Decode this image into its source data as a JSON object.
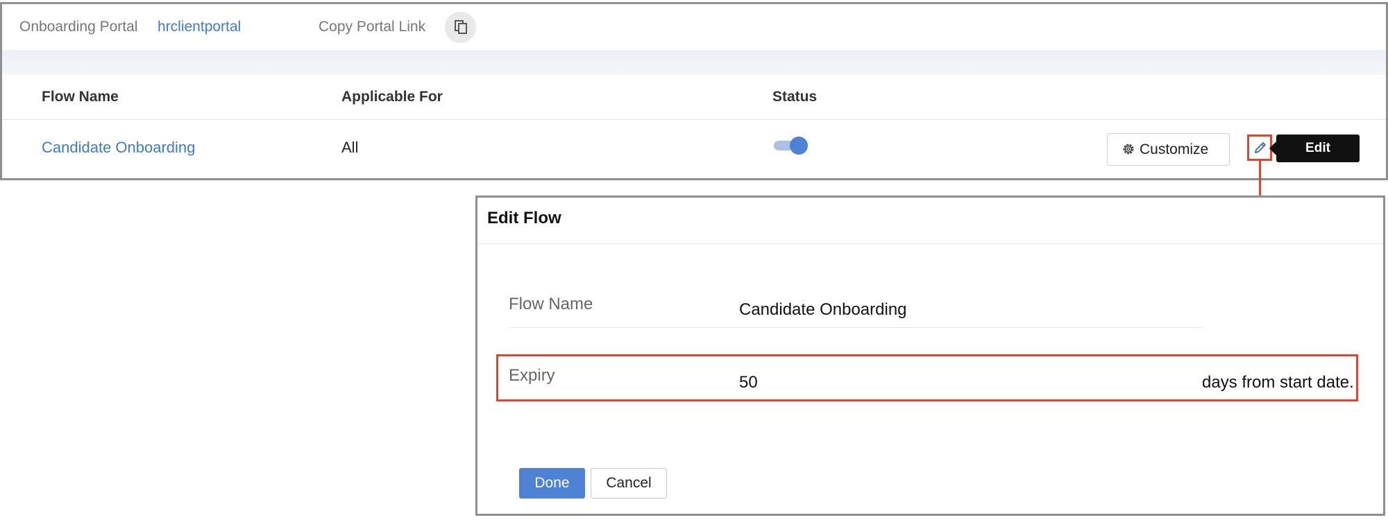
{
  "portal_bar": {
    "label": "Onboarding Portal",
    "portal_name": "hrclientportal",
    "copy_label": "Copy Portal Link",
    "copy_icon": "copy-icon"
  },
  "table": {
    "columns": [
      "Flow Name",
      "Applicable For",
      "Status"
    ],
    "rows": [
      {
        "flow_name": "Candidate Onboarding",
        "applicable_for": "All",
        "status_enabled": true
      }
    ],
    "customize_label": "Customize",
    "customize_icon": "gear-icon",
    "edit_icon": "pencil-icon",
    "edit_tooltip": "Edit"
  },
  "dialog": {
    "title": "Edit Flow",
    "fields": {
      "flow_name_label": "Flow Name",
      "flow_name_value": "Candidate Onboarding",
      "expiry_label": "Expiry",
      "expiry_value": "50",
      "expiry_suffix": "days from start date."
    },
    "done_label": "Done",
    "cancel_label": "Cancel"
  },
  "colors": {
    "link": "#3f7bc6",
    "primary": "#4e82d4",
    "highlight": "#e0462f"
  }
}
